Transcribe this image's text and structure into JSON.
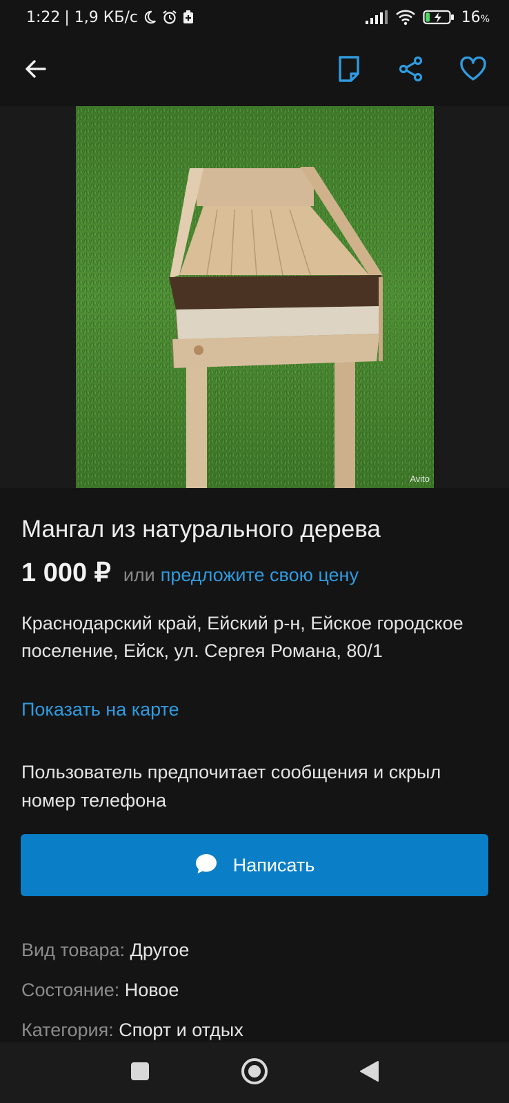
{
  "status": {
    "time": "1:22",
    "network_speed": "| 1,9 КБ/с",
    "battery": "16",
    "battery_unit": "%"
  },
  "toolbar": {
    "back_icon": "arrow-left-icon",
    "note_icon": "note-icon",
    "share_icon": "share-icon",
    "favorite_icon": "heart-icon",
    "accent_color": "#2f9be0"
  },
  "photo": {
    "watermark": "Avito"
  },
  "listing": {
    "title": "Мангал из натурального дерева",
    "price": "1 000 ₽",
    "price_or": "или",
    "offer_link": "предложите свою цену",
    "address": "Краснодарский край, Ейский р-н, Ейское городское поселение, Ейск, ул. Сергея Романа, 80/1",
    "map_link": "Показать на карте",
    "contact_notice": "Пользователь предпочитает сообщения и скрыл номер телефона",
    "write_button": "Написать",
    "button_color": "#0a7fc8"
  },
  "params": [
    {
      "key": "Вид товара:",
      "value": "Другое"
    },
    {
      "key": "Состояние:",
      "value": "Новое"
    },
    {
      "key": "Категория:",
      "value": "Спорт и отдых"
    }
  ],
  "navbar": {
    "recents_icon": "square-icon",
    "home_icon": "circle-icon",
    "back_icon": "triangle-back-icon"
  }
}
